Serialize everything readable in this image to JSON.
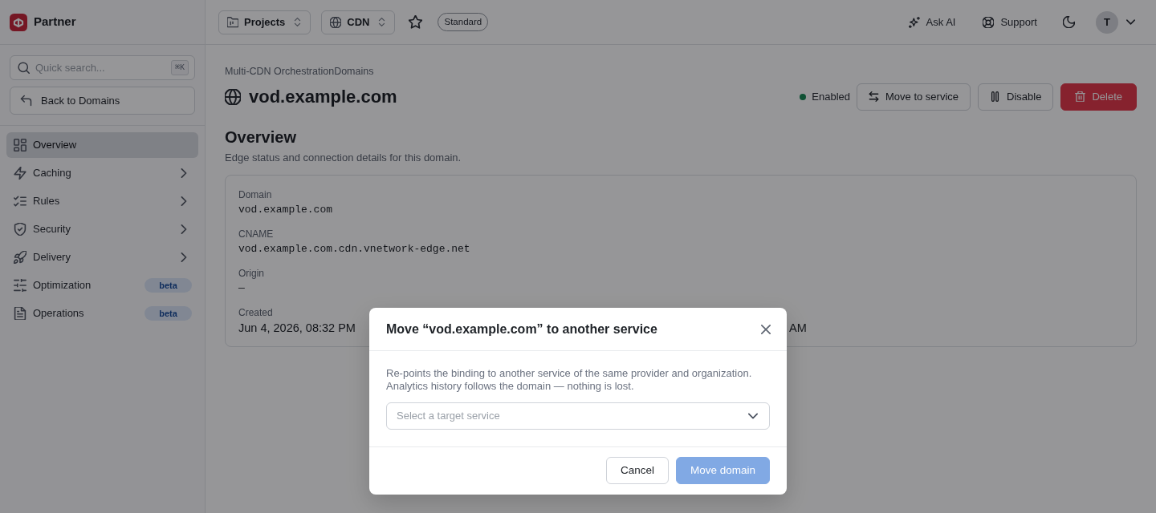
{
  "sidebar": {
    "brand": "Partner",
    "search": {
      "placeholder": "Quick search...",
      "shortcut": "⌘K"
    },
    "back_button": "Back to Domains",
    "items": [
      {
        "label": "Overview",
        "selected": true,
        "expandable": false
      },
      {
        "label": "Caching",
        "selected": false,
        "expandable": true
      },
      {
        "label": "Rules",
        "selected": false,
        "expandable": true
      },
      {
        "label": "Security",
        "selected": false,
        "expandable": true
      },
      {
        "label": "Delivery",
        "selected": false,
        "expandable": true
      },
      {
        "label": "Optimization",
        "selected": false,
        "expandable": false,
        "badge": "beta"
      },
      {
        "label": "Operations",
        "selected": false,
        "expandable": false,
        "badge": "beta"
      }
    ]
  },
  "topbar": {
    "selectors": [
      "Projects",
      "CDN"
    ],
    "starred": false,
    "plan_badge": "Standard",
    "actions": [
      "Ask AI",
      "Support"
    ],
    "avatar": "T"
  },
  "page": {
    "breadcrumb": "Multi-CDN OrchestrationDomains",
    "title": "vod.example.com",
    "status": {
      "label": "Enabled",
      "enabled": true
    },
    "buttons": [
      {
        "label": "Move to service",
        "kind": "outline"
      },
      {
        "label": "Disable",
        "kind": "outline"
      },
      {
        "label": "Delete",
        "kind": "danger"
      }
    ],
    "section_title": "Overview",
    "section_subtitle": "Edge status and connection details for this domain.",
    "fields": [
      {
        "label": "Domain",
        "value": "vod.example.com",
        "kind": "code"
      },
      {
        "label": "CNAME",
        "value": "vod.example.com.cdn.vnetwork-edge.net",
        "kind": "code"
      },
      {
        "label": "Origin",
        "value": "—",
        "kind": "code"
      },
      {
        "label": "Created",
        "value": "Jun 4, 2026, 08:32 PM",
        "kind": "text",
        "column_2_value": "AM"
      }
    ]
  },
  "modal": {
    "title": "Move “vod.example.com” to another service",
    "description": "Re-points the binding to another service of the same provider and organization. Analytics history follows the domain — nothing is lost.",
    "select": {
      "placeholder": "Select a target service"
    },
    "buttons": [
      {
        "label": "Cancel",
        "kind": "secondary",
        "disabled": false
      },
      {
        "label": "Move domain",
        "kind": "primary",
        "disabled": true
      }
    ]
  }
}
